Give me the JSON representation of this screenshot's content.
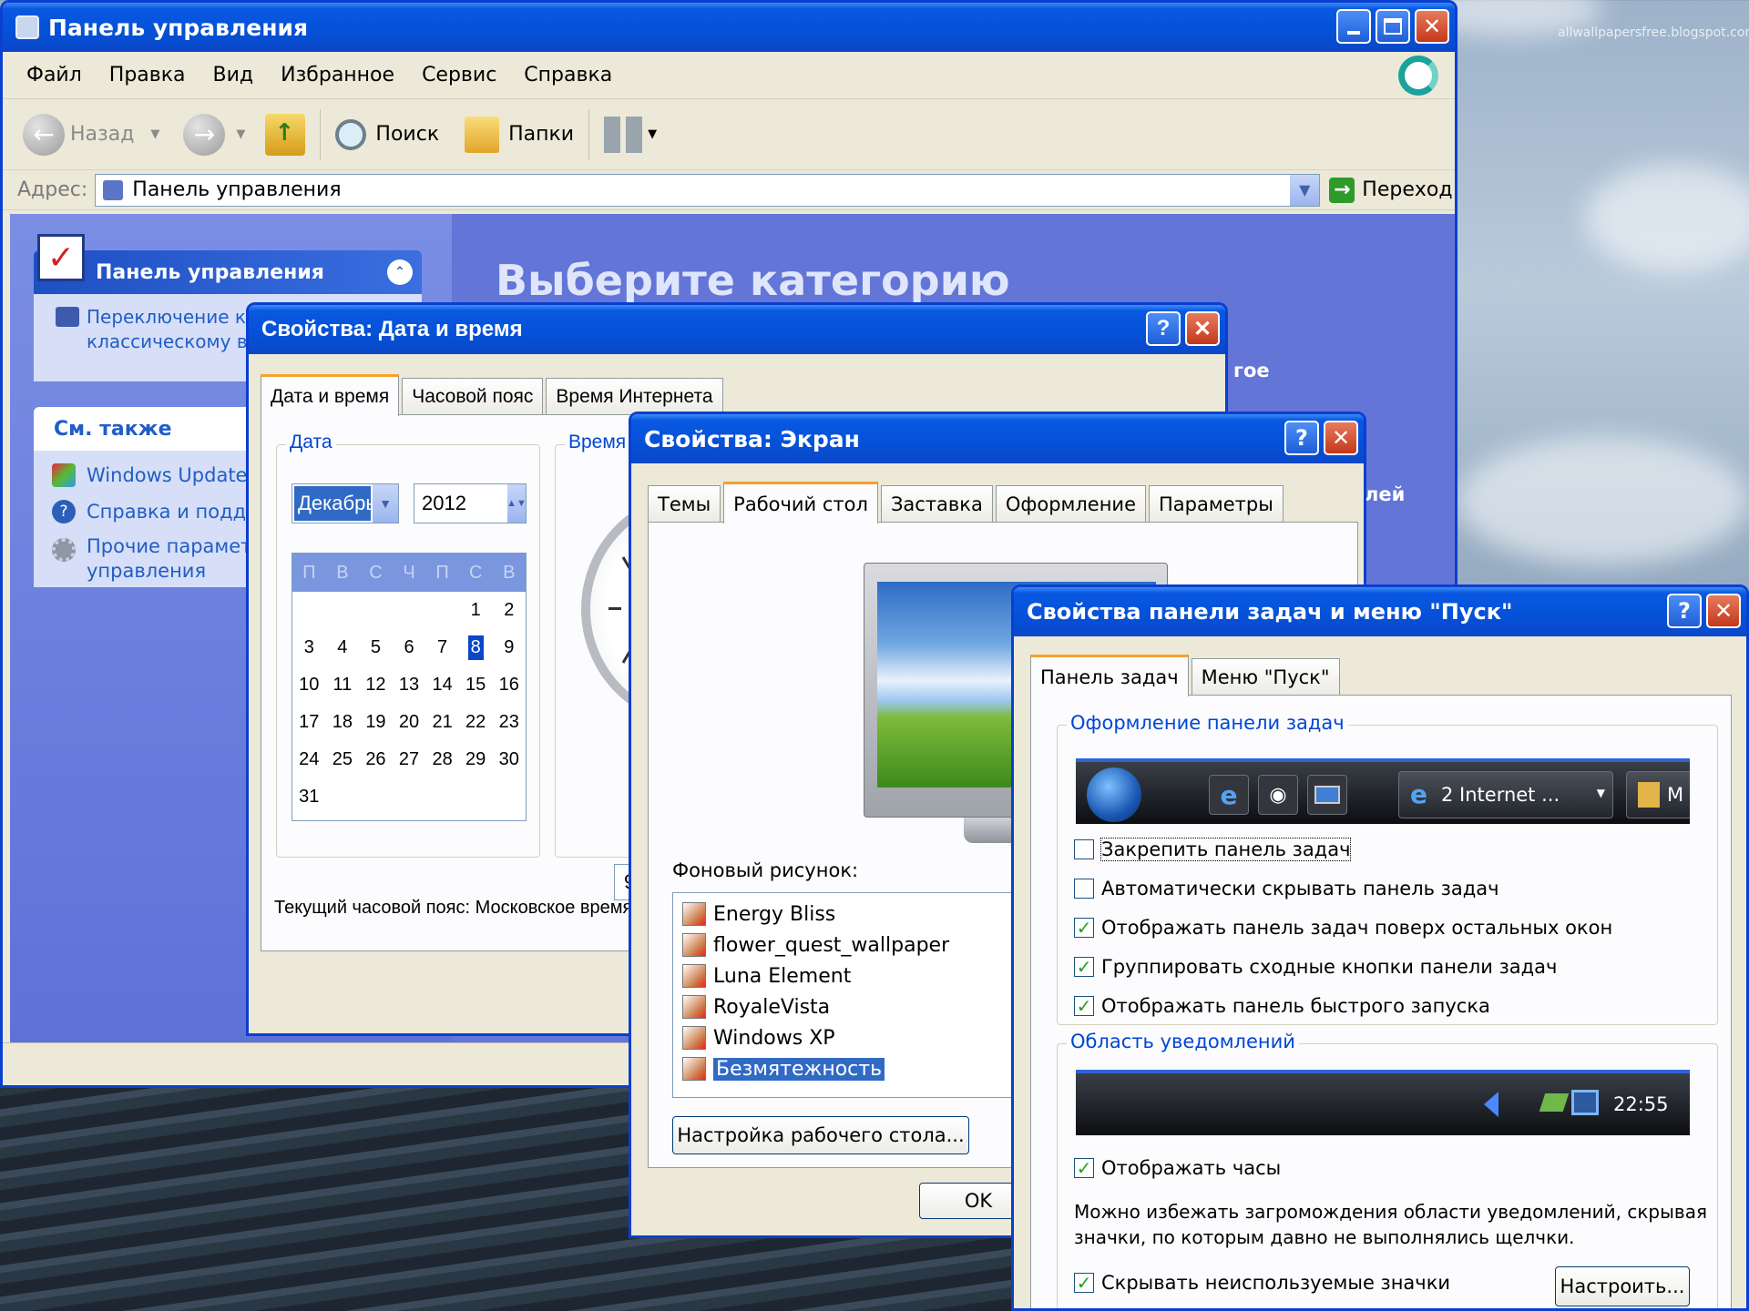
{
  "desktop": {
    "watermark": "allwallpapersfree.blogspot.com"
  },
  "cp": {
    "title": "Панель управления",
    "menu": [
      "Файл",
      "Правка",
      "Вид",
      "Избранное",
      "Сервис",
      "Справка"
    ],
    "toolbar": {
      "back": "Назад",
      "search": "Поиск",
      "folders": "Папки"
    },
    "address": {
      "label": "Адрес:",
      "value": "Панель управления",
      "go": "Переход"
    },
    "sidebar": {
      "header": "Панель управления",
      "switch_line1": "Переключение к",
      "switch_line2": "классическому в",
      "see_also": "См. также",
      "links": [
        "Windows Update",
        "Справка и подде",
        "Прочие парамет",
        "управления"
      ]
    },
    "main": {
      "heading": "Выберите категорию",
      "peek1": "гое",
      "peek2": "лей"
    }
  },
  "dt": {
    "title": "Свойства: Дата и время",
    "tabs": [
      "Дата и время",
      "Часовой пояс",
      "Время Интернета"
    ],
    "date_group": "Дата",
    "time_group": "Время",
    "month": "Декабрь",
    "year": "2012",
    "weekdays": [
      "П",
      "В",
      "С",
      "Ч",
      "П",
      "С",
      "В"
    ],
    "days": [
      [
        "",
        "",
        "",
        "",
        "",
        "1",
        "2"
      ],
      [
        "3",
        "4",
        "5",
        "6",
        "7",
        "8",
        "9"
      ],
      [
        "10",
        "11",
        "12",
        "13",
        "14",
        "15",
        "16"
      ],
      [
        "17",
        "18",
        "19",
        "20",
        "21",
        "22",
        "23"
      ],
      [
        "24",
        "25",
        "26",
        "27",
        "28",
        "29",
        "30"
      ],
      [
        "31",
        "",
        "",
        "",
        "",
        "",
        ""
      ]
    ],
    "selected_day": "8",
    "time_peek": "9",
    "timezone": "Текущий часовой пояс: Московское время (зима"
  },
  "scr": {
    "title": "Свойства: Экран",
    "tabs": [
      "Темы",
      "Рабочий стол",
      "Заставка",
      "Оформление",
      "Параметры"
    ],
    "bg_label": "Фоновый рисунок:",
    "items": [
      "Energy Bliss",
      "flower_quest_wallpaper",
      "Luna Element",
      "RoyaleVista",
      "Windows XP",
      "Безмятежность"
    ],
    "selected": "Безмятежность",
    "customize": "Настройка рабочего стола...",
    "ok": "OK"
  },
  "tb": {
    "title": "Свойства панели задач и меню \"Пуск\"",
    "tabs": [
      "Панель задач",
      "Меню \"Пуск\""
    ],
    "group1": "Оформление панели задач",
    "preview_btn": "2 Internet ...",
    "preview_peek": "M",
    "checks": [
      {
        "label": "Закрепить панель задач",
        "checked": false
      },
      {
        "label": "Автоматически скрывать панель задач",
        "checked": false
      },
      {
        "label": "Отображать панель задач поверх остальных окон",
        "checked": true
      },
      {
        "label": "Группировать сходные кнопки панели задач",
        "checked": true
      },
      {
        "label": "Отображать панель быстрого запуска",
        "checked": true
      }
    ],
    "group2": "Область уведомлений",
    "clock": "22:55",
    "show_clock": "Отображать часы",
    "note_line1": "Можно избежать загромождения области уведомлений, скрывая",
    "note_line2": "значки, по которым давно не выполнялись щелчки.",
    "hide_icons": "Скрывать неиспользуемые значки",
    "customize": "Настроить..."
  },
  "colors": {
    "xp_blue": "#0a58e2",
    "cp_body": "#6375d6",
    "sidebar": "#d6dff7",
    "selection": "#316ac5"
  }
}
